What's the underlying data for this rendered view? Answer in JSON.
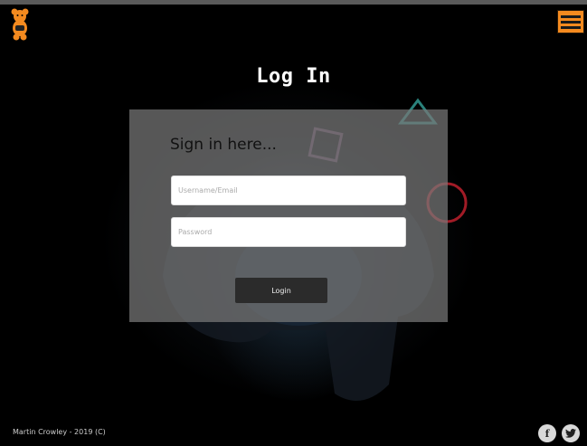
{
  "header": {
    "logo_icon": "teddy-bear-icon",
    "menu_icon": "hamburger-menu-icon",
    "accent_color": "#f48a1f"
  },
  "page": {
    "title": "Log In"
  },
  "login_form": {
    "heading": "Sign in here...",
    "username_placeholder": "Username/Email",
    "password_placeholder": "Password",
    "submit_label": "Login"
  },
  "footer": {
    "copyright": "Martin Crowley - 2019 (C)",
    "social": [
      {
        "icon": "facebook-icon",
        "glyph": "f"
      },
      {
        "icon": "twitter-icon",
        "glyph": "🐦"
      }
    ]
  }
}
